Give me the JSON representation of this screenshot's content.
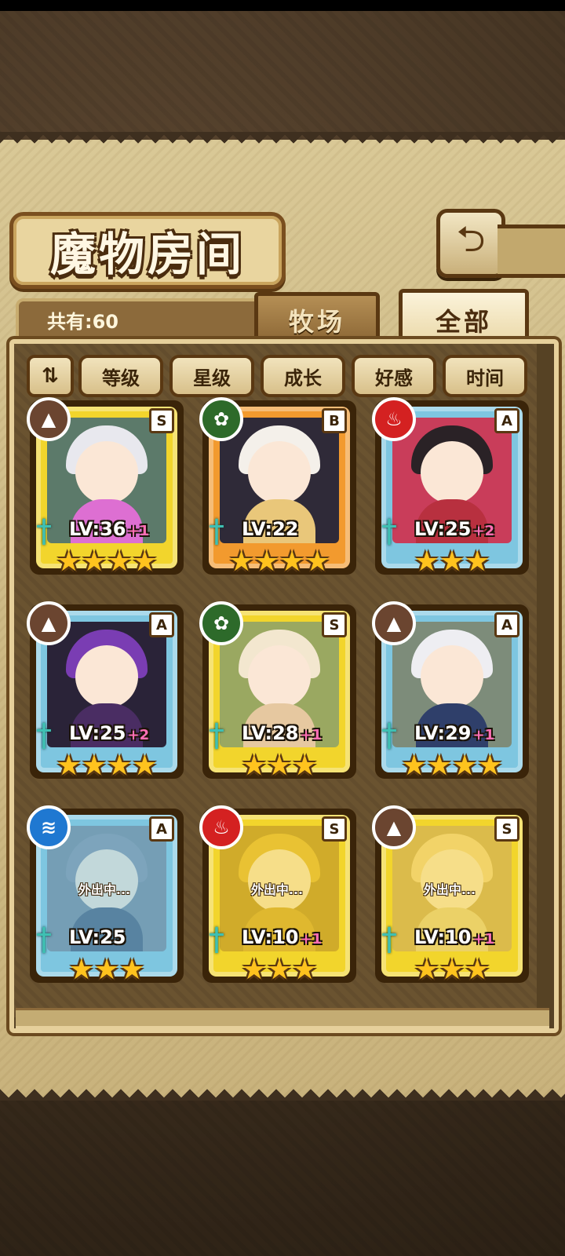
{
  "header": {
    "title": "魔物房间",
    "back_icon": "back-arrow-icon"
  },
  "summary": {
    "count_label": "共有:60"
  },
  "tabs": [
    {
      "label": "牧场",
      "active": false
    },
    {
      "label": "全部",
      "active": true
    }
  ],
  "sort": {
    "toggle_icon": "sort-order-icon",
    "toggle_glyph": "⇅",
    "buttons": [
      "等级",
      "星级",
      "成长",
      "好感",
      "时间"
    ]
  },
  "monsters": [
    {
      "level": "LV:36",
      "bonus": "+1",
      "rank": "S",
      "element": "earth",
      "stars": 4,
      "frame": "gold",
      "status": ""
    },
    {
      "level": "LV:22",
      "bonus": "",
      "rank": "B",
      "element": "wood",
      "stars": 4,
      "frame": "orange",
      "status": ""
    },
    {
      "level": "LV:25",
      "bonus": "+2",
      "rank": "A",
      "element": "fire",
      "stars": 3,
      "frame": "blue",
      "status": ""
    },
    {
      "level": "LV:25",
      "bonus": "+2",
      "rank": "A",
      "element": "earth",
      "stars": 4,
      "frame": "blue",
      "status": ""
    },
    {
      "level": "LV:28",
      "bonus": "+1",
      "rank": "S",
      "element": "wood",
      "stars": 3,
      "frame": "gold",
      "status": ""
    },
    {
      "level": "LV:29",
      "bonus": "+1",
      "rank": "A",
      "element": "earth",
      "stars": 4,
      "frame": "blue",
      "status": ""
    },
    {
      "level": "LV:25",
      "bonus": "",
      "rank": "A",
      "element": "water",
      "stars": 3,
      "frame": "blue",
      "status": "外出中..."
    },
    {
      "level": "LV:10",
      "bonus": "+1",
      "rank": "S",
      "element": "fire",
      "stars": 3,
      "frame": "gold",
      "status": "外出中..."
    },
    {
      "level": "LV:10",
      "bonus": "+1",
      "rank": "S",
      "element": "earth",
      "stars": 3,
      "frame": "gold",
      "status": "外出中..."
    }
  ],
  "colors": {
    "frame_gold": "#f2d52c",
    "frame_orange": "#f29a2e",
    "frame_blue": "#7ec6e0",
    "element_earth": "#6b4530",
    "element_wood": "#2d6a2a",
    "element_fire": "#d42121",
    "element_water": "#1f78d1"
  }
}
